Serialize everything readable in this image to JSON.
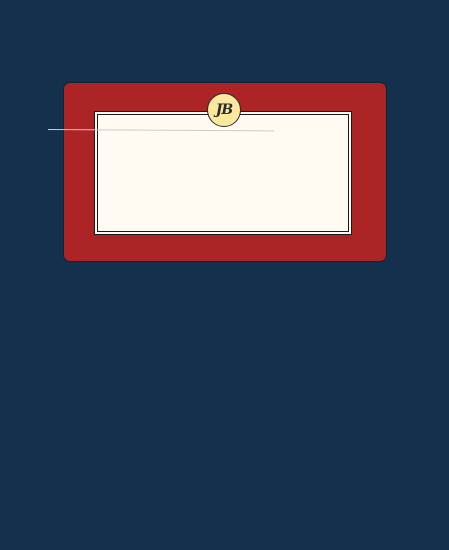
{
  "app": {
    "background_color": "#13304d"
  },
  "card": {
    "background_color": "#ad2426",
    "label_color": "#fffaf2"
  },
  "monogram": {
    "text": "JB",
    "color": "#fbe89e"
  }
}
